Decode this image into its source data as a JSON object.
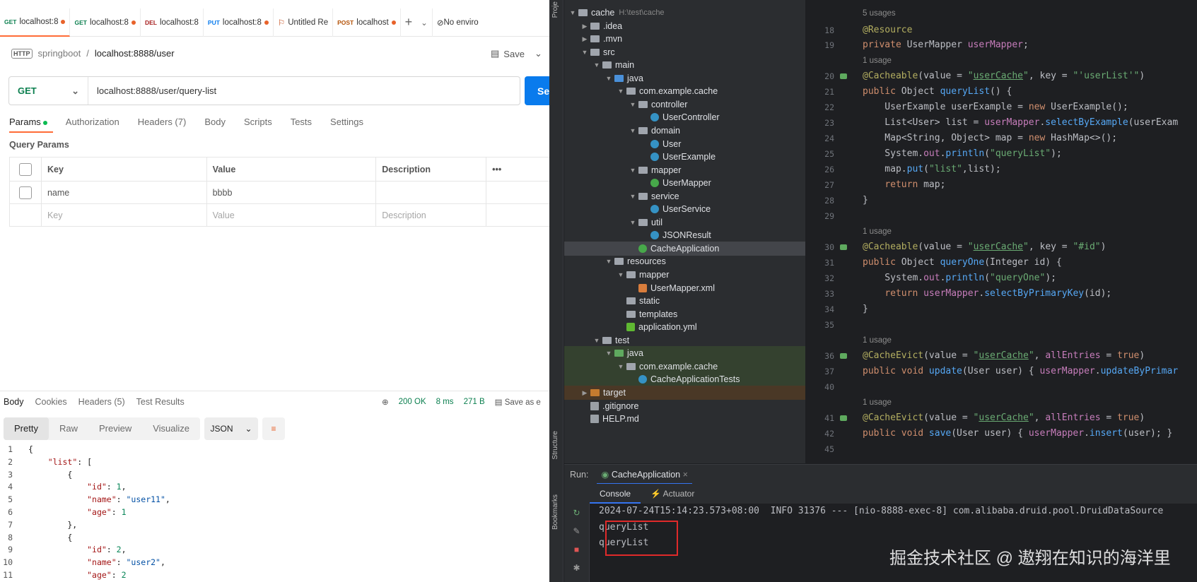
{
  "postman": {
    "tabs": [
      {
        "method": "GET",
        "label": "localhost:8",
        "dot": true,
        "color": "#0d8050"
      },
      {
        "method": "GET",
        "label": "localhost:8",
        "dot": true,
        "color": "#0d8050"
      },
      {
        "method": "DEL",
        "label": "localhost:8",
        "dot": false,
        "color": "#a61e1e"
      },
      {
        "method": "PUT",
        "label": "localhost:8",
        "dot": true,
        "color": "#097bed"
      },
      {
        "method": "",
        "label": "Untitled Re",
        "dot": false,
        "color": "#c2410c"
      },
      {
        "method": "POST",
        "label": "localhost",
        "dot": true,
        "color": "#b45309"
      }
    ],
    "env_label": "No enviro",
    "breadcrumb": {
      "icon": "HTTP",
      "parent": "springboot",
      "sep": "/",
      "current": "localhost:8888/user"
    },
    "save_label": "Save",
    "method": "GET",
    "url": "localhost:8888/user/query-list",
    "send_label": "Se",
    "param_tabs": [
      "Params",
      "Authorization",
      "Headers (7)",
      "Body",
      "Scripts",
      "Tests",
      "Settings"
    ],
    "query_params_title": "Query Params",
    "table_headers": {
      "key": "Key",
      "value": "Value",
      "description": "Description",
      "more": "•••"
    },
    "rows": [
      {
        "key": "name",
        "value": "bbbb",
        "description": ""
      }
    ],
    "placeholder_row": {
      "key": "Key",
      "value": "Value",
      "description": "Description"
    },
    "response_tabs": [
      "Body",
      "Cookies",
      "Headers (5)",
      "Test Results"
    ],
    "status": "200 OK",
    "time": "8 ms",
    "size": "271 B",
    "save_as": "Save as e",
    "format_tabs": [
      "Pretty",
      "Raw",
      "Preview",
      "Visualize"
    ],
    "format_select": "JSON",
    "json_lines": [
      {
        "n": "1",
        "t": "{"
      },
      {
        "n": "2",
        "t": "    \"list\": ["
      },
      {
        "n": "3",
        "t": "        {"
      },
      {
        "n": "4",
        "t": "            \"id\": 1,"
      },
      {
        "n": "5",
        "t": "            \"name\": \"user11\","
      },
      {
        "n": "6",
        "t": "            \"age\": 1"
      },
      {
        "n": "7",
        "t": "        },"
      },
      {
        "n": "8",
        "t": "        {"
      },
      {
        "n": "9",
        "t": "            \"id\": 2,"
      },
      {
        "n": "10",
        "t": "            \"name\": \"user2\","
      },
      {
        "n": "11",
        "t": "            \"age\": 2"
      }
    ]
  },
  "ide": {
    "side_labels": {
      "project": "Proje",
      "structure": "Structure",
      "bookmarks": "Bookmarks"
    },
    "tree": [
      {
        "label": "cache",
        "hint": "H:\\test\\cache",
        "indent": 0,
        "arrow": "v",
        "icon": "folder"
      },
      {
        "label": ".idea",
        "indent": 1,
        "arrow": ">",
        "icon": "folder"
      },
      {
        "label": ".mvn",
        "indent": 1,
        "arrow": ">",
        "icon": "folder"
      },
      {
        "label": "src",
        "indent": 1,
        "arrow": "v",
        "icon": "folder"
      },
      {
        "label": "main",
        "indent": 2,
        "arrow": "v",
        "icon": "folder"
      },
      {
        "label": "java",
        "indent": 3,
        "arrow": "v",
        "icon": "folder-blue"
      },
      {
        "label": "com.example.cache",
        "indent": 4,
        "arrow": "v",
        "icon": "folder"
      },
      {
        "label": "controller",
        "indent": 5,
        "arrow": "v",
        "icon": "folder"
      },
      {
        "label": "UserController",
        "indent": 6,
        "arrow": "",
        "icon": "class"
      },
      {
        "label": "domain",
        "indent": 5,
        "arrow": "v",
        "icon": "folder"
      },
      {
        "label": "User",
        "indent": 6,
        "arrow": "",
        "icon": "class"
      },
      {
        "label": "UserExample",
        "indent": 6,
        "arrow": "",
        "icon": "class"
      },
      {
        "label": "mapper",
        "indent": 5,
        "arrow": "v",
        "icon": "folder"
      },
      {
        "label": "UserMapper",
        "indent": 6,
        "arrow": "",
        "icon": "interface"
      },
      {
        "label": "service",
        "indent": 5,
        "arrow": "v",
        "icon": "folder"
      },
      {
        "label": "UserService",
        "indent": 6,
        "arrow": "",
        "icon": "class"
      },
      {
        "label": "util",
        "indent": 5,
        "arrow": "v",
        "icon": "folder"
      },
      {
        "label": "JSONResult",
        "indent": 6,
        "arrow": "",
        "icon": "class"
      },
      {
        "label": "CacheApplication",
        "indent": 5,
        "arrow": "",
        "icon": "spring",
        "sel": true
      },
      {
        "label": "resources",
        "indent": 3,
        "arrow": "v",
        "icon": "folder"
      },
      {
        "label": "mapper",
        "indent": 4,
        "arrow": "v",
        "icon": "folder"
      },
      {
        "label": "UserMapper.xml",
        "indent": 5,
        "arrow": "",
        "icon": "xml"
      },
      {
        "label": "static",
        "indent": 4,
        "arrow": "",
        "icon": "folder"
      },
      {
        "label": "templates",
        "indent": 4,
        "arrow": "",
        "icon": "folder"
      },
      {
        "label": "application.yml",
        "indent": 4,
        "arrow": "",
        "icon": "yml"
      },
      {
        "label": "test",
        "indent": 2,
        "arrow": "v",
        "icon": "folder"
      },
      {
        "label": "java",
        "indent": 3,
        "arrow": "v",
        "icon": "folder-green",
        "test": true
      },
      {
        "label": "com.example.cache",
        "indent": 4,
        "arrow": "v",
        "icon": "folder",
        "test": true
      },
      {
        "label": "CacheApplicationTests",
        "indent": 5,
        "arrow": "",
        "icon": "class",
        "test": true
      },
      {
        "label": "target",
        "indent": 1,
        "arrow": ">",
        "icon": "folder-orange",
        "tgt": true
      },
      {
        "label": ".gitignore",
        "indent": 1,
        "arrow": "",
        "icon": "file"
      },
      {
        "label": "HELP.md",
        "indent": 1,
        "arrow": "",
        "icon": "file"
      }
    ],
    "usages": {
      "u5": "5 usages",
      "u1": "1 usage"
    },
    "line_numbers": [
      "18",
      "19",
      "20",
      "21",
      "22",
      "23",
      "24",
      "25",
      "26",
      "27",
      "28",
      "29",
      "30",
      "31",
      "32",
      "33",
      "34",
      "35",
      "36",
      "37",
      "40",
      "41",
      "42",
      "45"
    ],
    "run_label": "Run:",
    "run_tab": "CacheApplication",
    "console_tabs": [
      "Console",
      "Actuator"
    ],
    "console_lines": [
      "2024-07-24T15:14:23.573+08:00  INFO 31376 --- [nio-8888-exec-8] com.alibaba.druid.pool.DruidDataSource",
      "queryList",
      "queryList"
    ],
    "watermark": "掘金技术社区 @ 遨翔在知识的海洋里"
  }
}
